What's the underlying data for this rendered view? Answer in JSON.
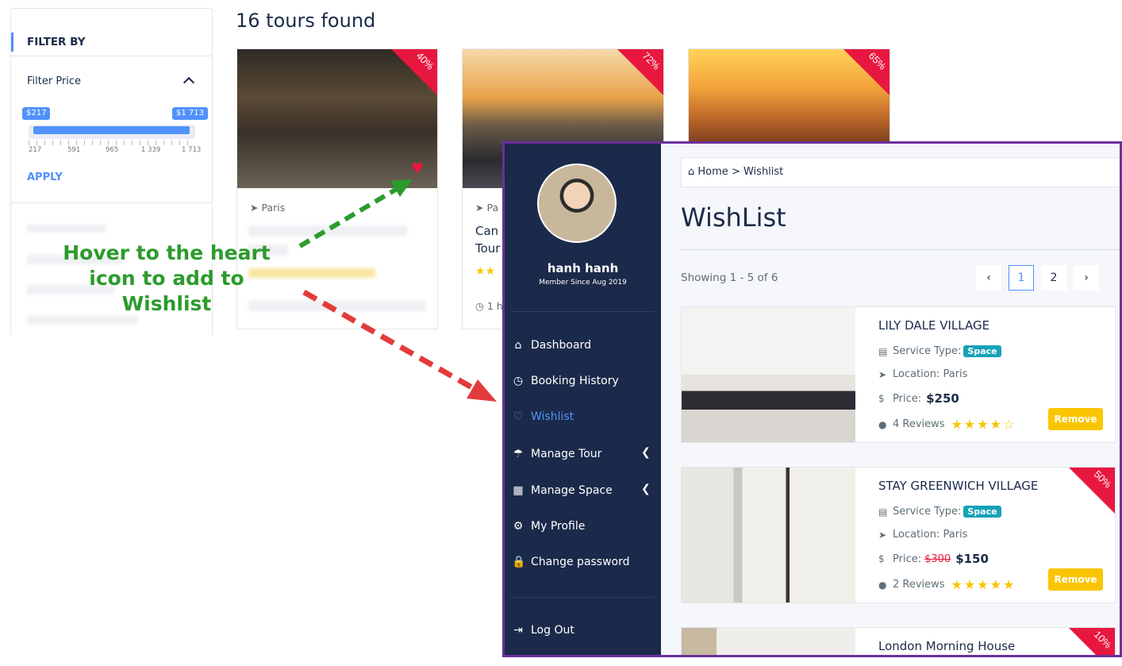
{
  "filter": {
    "title": "FILTER BY",
    "price_label": "Filter Price",
    "min_tag": "$217",
    "max_tag": "$1 713",
    "ticks": [
      "217",
      "591",
      "965",
      "1 339",
      "1 713"
    ],
    "apply": "APPLY"
  },
  "listing": {
    "found": "16 tours found",
    "cards": [
      {
        "discount": "40%",
        "location": "Paris"
      },
      {
        "discount": "72%",
        "location": "Pa",
        "title_fragment": "Can",
        "title_fragment2": "Tour",
        "duration_fragment": "1 h"
      },
      {
        "discount": "65%"
      }
    ]
  },
  "annotation": {
    "line1": "Hover to the heart",
    "line2": "icon to add to Wishlist"
  },
  "sidebar": {
    "user_name": "hanh hanh",
    "member_since": "Member Since Aug 2019",
    "menu": [
      {
        "label": "Dashboard",
        "icon": "home-icon"
      },
      {
        "label": "Booking History",
        "icon": "clock-icon"
      },
      {
        "label": "Wishlist",
        "icon": "heart-icon"
      },
      {
        "label": "Manage Tour",
        "icon": "umbrella-icon"
      },
      {
        "label": "Manage Space",
        "icon": "building-icon"
      },
      {
        "label": "My Profile",
        "icon": "gears-icon"
      },
      {
        "label": "Change password",
        "icon": "lock-icon"
      }
    ],
    "logout": "Log Out"
  },
  "main": {
    "breadcrumb_home": "Home",
    "breadcrumb_sep": ">",
    "breadcrumb_current": "Wishlist",
    "title": "WishList",
    "showing": "Showing 1 - 5 of 6",
    "pagination": {
      "prev": "‹",
      "pages": [
        "1",
        "2"
      ],
      "next": "›",
      "current": "1"
    },
    "items": [
      {
        "title": "LILY DALE VILLAGE",
        "service_label": "Service Type:",
        "service": "Space",
        "location": "Location: Paris",
        "price_label": "Price:",
        "price": "$250",
        "reviews": "4 Reviews",
        "stars": "★★★★☆",
        "remove": "Remove"
      },
      {
        "title": "STAY GREENWICH VILLAGE",
        "service_label": "Service Type:",
        "service": "Space",
        "location": "Location: Paris",
        "price_label": "Price:",
        "old_price": "$300",
        "price": "$150",
        "reviews": "2 Reviews",
        "stars": "★★★★★",
        "remove": "Remove",
        "discount": "50%"
      },
      {
        "title": "London Morning House",
        "discount": "10%"
      }
    ]
  },
  "colors": {
    "accent": "#5191fa",
    "sidebar": "#1b2a4a",
    "sale": "#e8173f",
    "remove": "#fac500",
    "panel_border": "#6b2f9a",
    "annotation": "#2c9b2c"
  }
}
